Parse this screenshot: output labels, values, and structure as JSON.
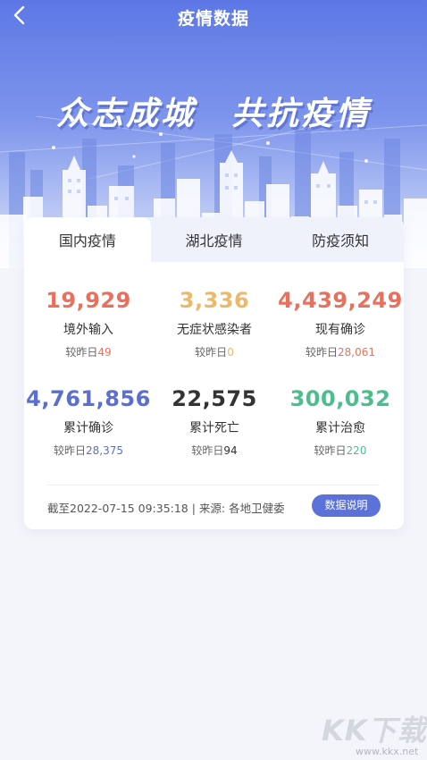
{
  "header": {
    "title": "疫情数据",
    "back_icon": "back-arrow-icon",
    "slogan_part1": "众志成城",
    "slogan_part2": "共抗疫情"
  },
  "tabs": [
    {
      "label": "国内疫情",
      "active": true
    },
    {
      "label": "湖北疫情",
      "active": false
    },
    {
      "label": "防疫须知",
      "active": false
    }
  ],
  "stats": [
    {
      "value": "19,929",
      "label": "境外输入",
      "compare_prefix": "较昨日",
      "compare_value": "49",
      "color": "#e8715d"
    },
    {
      "value": "3,336",
      "label": "无症状感染者",
      "compare_prefix": "较昨日",
      "compare_value": "0",
      "color": "#ecb86a"
    },
    {
      "value": "4,439,249",
      "label": "现有确诊",
      "compare_prefix": "较昨日",
      "compare_value": "28,061",
      "color": "#e8715d"
    },
    {
      "value": "4,761,856",
      "label": "累计确诊",
      "compare_prefix": "较昨日",
      "compare_value": "28,375",
      "color": "#5a6fd0"
    },
    {
      "value": "22,575",
      "label": "累计死亡",
      "compare_prefix": "较昨日",
      "compare_value": "94",
      "color": "#333333"
    },
    {
      "value": "300,032",
      "label": "累计治愈",
      "compare_prefix": "较昨日",
      "compare_value": "220",
      "color": "#4dbd8e"
    }
  ],
  "footer": {
    "timestamp_text": "截至2022-07-15 09:35:18 | 来源: 各地卫健委",
    "explain_button": "数据说明"
  },
  "watermark": {
    "brand": "KK下载",
    "url": "www.kkx.net"
  },
  "colors": {
    "primary": "#5d72d8",
    "hero_top": "#5d78e6",
    "red": "#e8715d",
    "orange": "#ecb86a",
    "blue": "#5a6fd0",
    "green": "#4dbd8e"
  }
}
